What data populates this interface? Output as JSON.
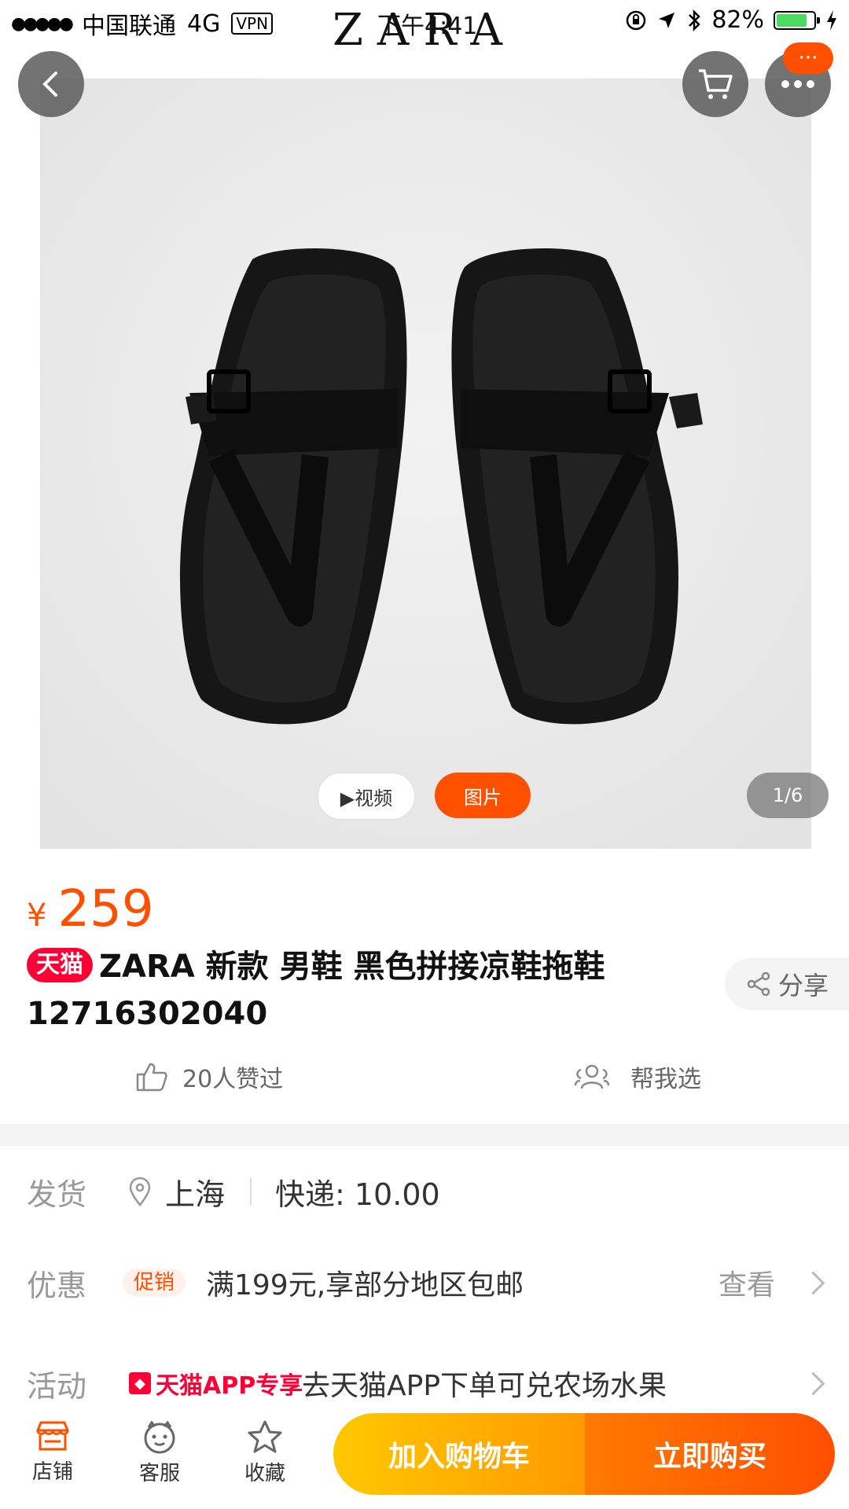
{
  "status_bar": {
    "signal_dots": "●●●●●",
    "carrier": "中国联通",
    "network": "4G",
    "vpn": "VPN",
    "brand": "ZARA",
    "time": "下午4:41",
    "battery_percent": "82%",
    "battery_level": 0.82
  },
  "gallery": {
    "video_label": "▶视频",
    "image_label": "图片",
    "counter": "1/6",
    "more_badge": "···",
    "colors": {
      "background": "#e9e9e9",
      "accent": "#ff5000"
    }
  },
  "product": {
    "currency": "¥",
    "price": "259",
    "tmall_tag": "天猫",
    "title": "ZARA 新款 男鞋 黑色拼接凉鞋拖鞋 12716302040",
    "share_label": "分享",
    "likes_label": "20人赞过",
    "help_choose_label": "帮我选"
  },
  "shipping": {
    "label": "发货",
    "location": "上海",
    "fee": "快递: 10.00"
  },
  "promotion": {
    "label": "优惠",
    "tag": "促销",
    "text": "满199元,享部分地区包邮",
    "view_label": "查看"
  },
  "activity": {
    "label": "活动",
    "tag": "天猫APP专享",
    "text": "去天猫APP下单可兑农场水果"
  },
  "bottom_bar": {
    "store_label": "店铺",
    "service_label": "客服",
    "favorite_label": "收藏",
    "add_to_cart_label": "加入购物车",
    "buy_now_label": "立即购买"
  }
}
